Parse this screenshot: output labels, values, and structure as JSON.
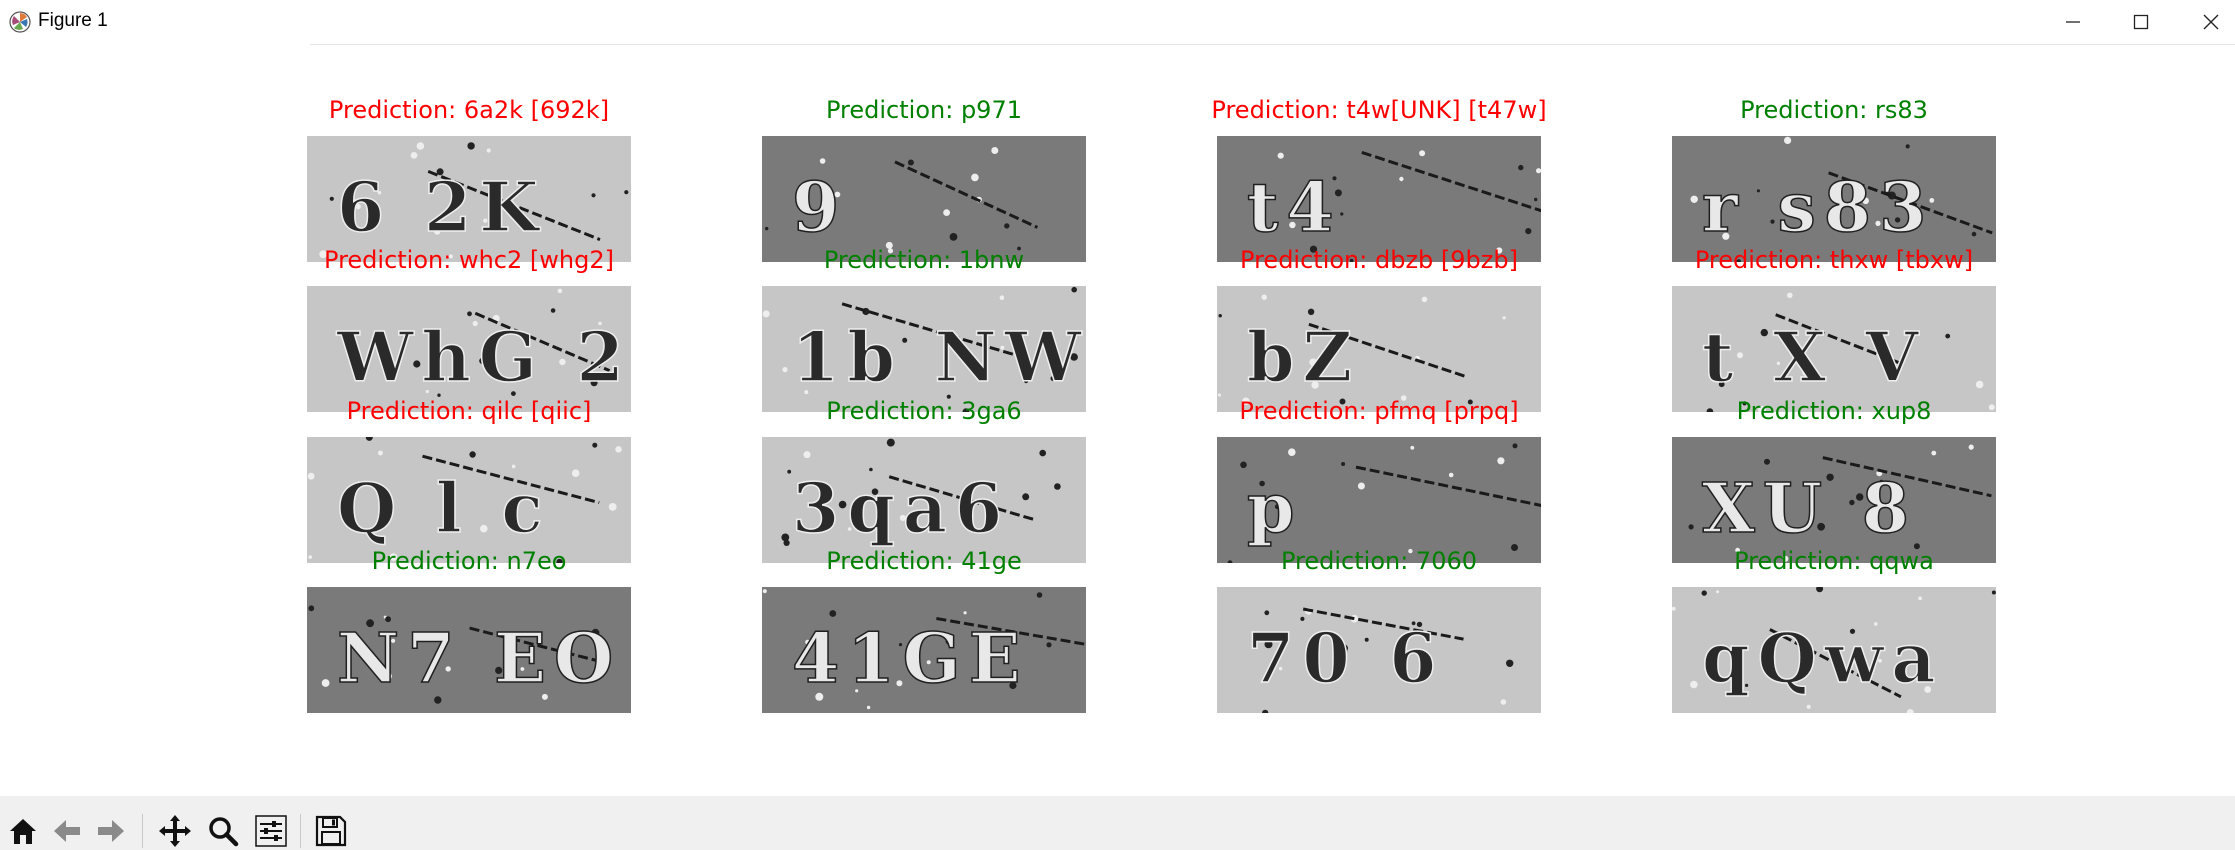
{
  "window": {
    "title": "Figure 1",
    "icons": [
      "matplotlib-icon",
      "minimize-icon",
      "maximize-icon",
      "close-icon"
    ]
  },
  "figure": {
    "rows": 4,
    "cols": 4,
    "predictions": [
      {
        "text": "Prediction: 6a2k [692k]",
        "status": "wrong",
        "image_text": "6 2K",
        "image_shade": "light"
      },
      {
        "text": "Prediction: p971",
        "status": "correct",
        "image_text": "9",
        "image_shade": "dark"
      },
      {
        "text": "Prediction: t4w[UNK] [t47w]",
        "status": "wrong",
        "image_text": "t4",
        "image_shade": "dark"
      },
      {
        "text": "Prediction: rs83",
        "status": "correct",
        "image_text": "r s83",
        "image_shade": "dark"
      },
      {
        "text": "Prediction: whc2 [whg2]",
        "status": "wrong",
        "image_text": "WhG 2",
        "image_shade": "light"
      },
      {
        "text": "Prediction: 1bnw",
        "status": "correct",
        "image_text": "1b NW",
        "image_shade": "light"
      },
      {
        "text": "Prediction: dbzb [9bzb]",
        "status": "wrong",
        "image_text": "bZ",
        "image_shade": "light"
      },
      {
        "text": "Prediction: thxw [tbxw]",
        "status": "wrong",
        "image_text": "t X V",
        "image_shade": "light"
      },
      {
        "text": "Prediction: qilc [qiic]",
        "status": "wrong",
        "image_text": "Q l c",
        "image_shade": "light"
      },
      {
        "text": "Prediction: 3ga6",
        "status": "correct",
        "image_text": "3qa6",
        "image_shade": "light"
      },
      {
        "text": "Prediction: pfmq [prpq]",
        "status": "wrong",
        "image_text": "p",
        "image_shade": "dark"
      },
      {
        "text": "Prediction: xup8",
        "status": "correct",
        "image_text": "XU 8",
        "image_shade": "dark"
      },
      {
        "text": "Prediction: n7eo",
        "status": "correct",
        "image_text": "N7 EO",
        "image_shade": "dark"
      },
      {
        "text": "Prediction: 41ge",
        "status": "correct",
        "image_text": "41GE",
        "image_shade": "dark"
      },
      {
        "text": "Prediction: 7060",
        "status": "correct",
        "image_text": "70 6",
        "image_shade": "light"
      },
      {
        "text": "Prediction: qqwa",
        "status": "correct",
        "image_text": "qQwa",
        "image_shade": "light"
      }
    ]
  },
  "colors": {
    "correct": "#008000",
    "wrong": "#ff0000",
    "toolbar_bg": "#f0f0f0",
    "image_light": "#c6c6c6",
    "image_dark": "#7a7a7a"
  },
  "toolbar": {
    "buttons": [
      "home-icon",
      "back-icon",
      "forward-icon",
      "pan-icon",
      "zoom-icon",
      "configure-subplots-icon",
      "save-icon"
    ]
  }
}
